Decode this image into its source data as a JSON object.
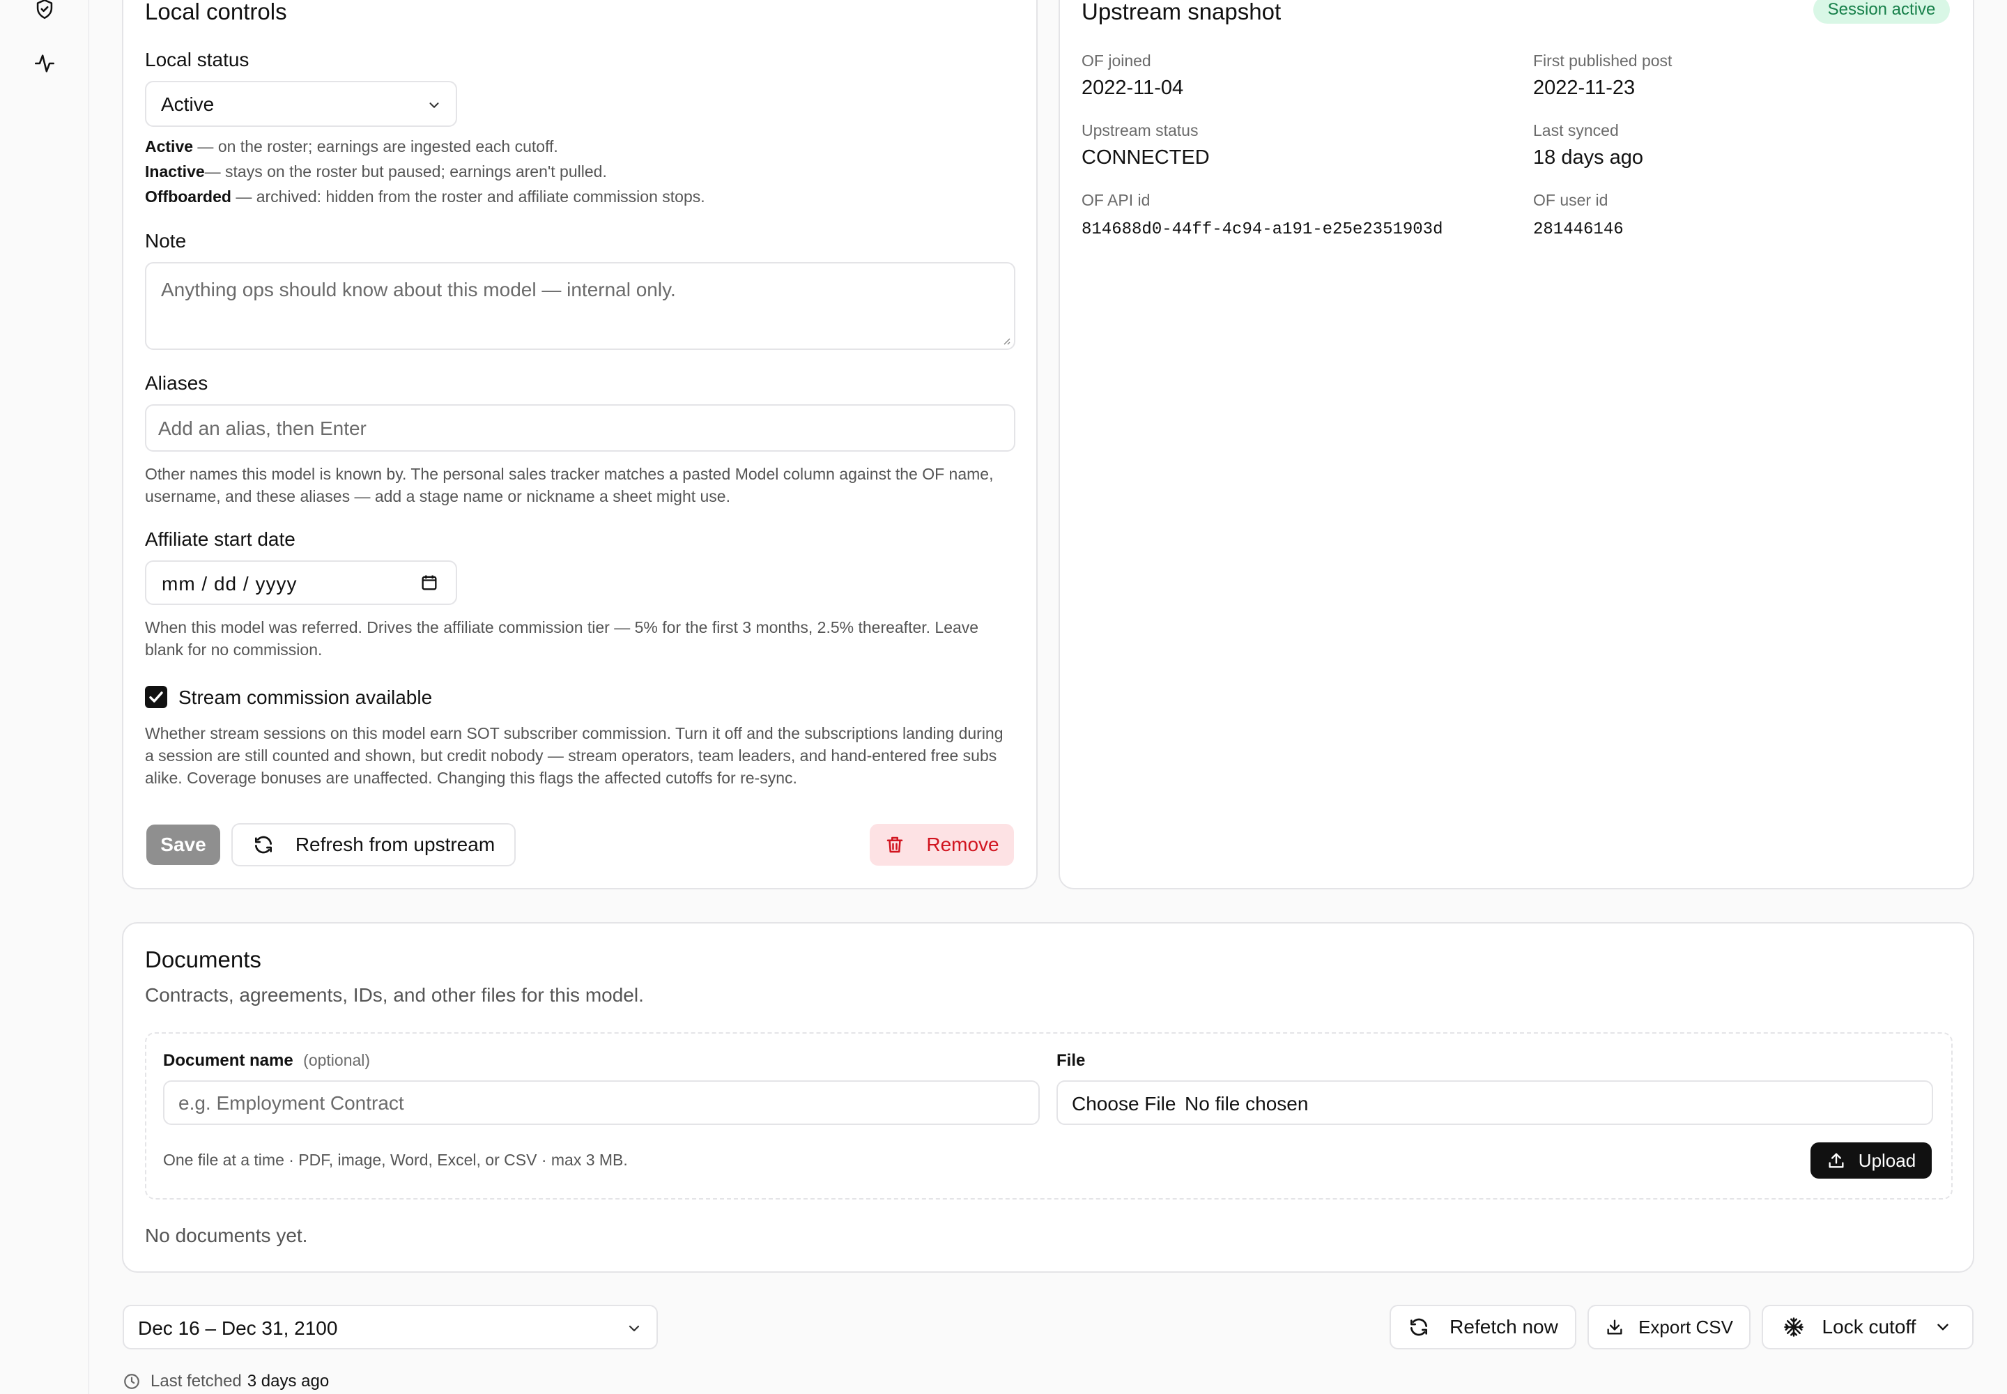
{
  "sidebar": {
    "items": [
      {
        "icon": "shield-check-icon"
      },
      {
        "icon": "activity-icon"
      }
    ]
  },
  "local_controls": {
    "title": "Local controls",
    "status_label": "Local status",
    "status_value": "Active",
    "status_help": [
      {
        "term": "Active",
        "desc": " — on the roster; earnings are ingested each cutoff."
      },
      {
        "term": "Inactive",
        "desc": "— stays on the roster but paused; earnings aren't pulled."
      },
      {
        "term": "Offboarded",
        "desc": " — archived: hidden from the roster and affiliate commission stops."
      }
    ],
    "note_label": "Note",
    "note_placeholder": "Anything ops should know about this model — internal only.",
    "aliases_label": "Aliases",
    "aliases_placeholder": "Add an alias, then Enter",
    "aliases_help": "Other names this model is known by. The personal sales tracker matches a pasted Model column against the OF name, username, and these aliases — add a stage name or nickname a sheet might use.",
    "affiliate_label": "Affiliate start date",
    "affiliate_placeholder": "mm / dd / yyyy",
    "affiliate_help": "When this model was referred. Drives the affiliate commission tier — 5% for the first 3 months, 2.5% thereafter. Leave blank for no commission.",
    "stream_label": "Stream commission available",
    "stream_checked": true,
    "stream_help": "Whether stream sessions on this model earn SOT subscriber commission. Turn it off and the subscriptions landing during a session are still counted and shown, but credit nobody — stream operators, team leaders, and hand-entered free subs alike. Coverage bonuses are unaffected. Changing this flags the affected cutoffs for re-sync.",
    "save_label": "Save",
    "refresh_label": "Refresh from upstream",
    "remove_label": "Remove"
  },
  "upstream": {
    "title": "Upstream snapshot",
    "badge": "Session active",
    "fields": [
      {
        "label": "OF joined",
        "value": "2022-11-04"
      },
      {
        "label": "First published post",
        "value": "2022-11-23"
      },
      {
        "label": "Upstream status",
        "value": "CONNECTED"
      },
      {
        "label": "Last synced",
        "value": "18 days ago"
      },
      {
        "label": "OF API id",
        "value": "814688d0-44ff-4c94-a191-e25e2351903d"
      },
      {
        "label": "OF user id",
        "value": "281446146"
      }
    ]
  },
  "documents": {
    "title": "Documents",
    "subtitle": "Contracts, agreements, IDs, and other files for this model.",
    "name_label": "Document name",
    "name_optional": "(optional)",
    "name_placeholder": "e.g. Employment Contract",
    "file_label": "File",
    "choose_file": "Choose File",
    "no_file": "No file chosen",
    "upload_help": "One file at a time · PDF, image, Word, Excel, or CSV · max 3 MB.",
    "upload_label": "Upload",
    "empty": "No documents yet."
  },
  "footer": {
    "range": "Dec 16 – Dec 31, 2100",
    "refetch_label": "Refetch now",
    "export_label": "Export CSV",
    "lock_label": "Lock cutoff",
    "last_fetched_prefix": "Last fetched",
    "last_fetched_value": "3 days ago"
  },
  "colors": {
    "badge_bg": "#d9f7e6",
    "badge_text": "#17804a",
    "remove_bg": "#fde2e4",
    "remove_text": "#d1141f",
    "save_bg": "#8f8f8f",
    "upload_bg": "#111111"
  }
}
